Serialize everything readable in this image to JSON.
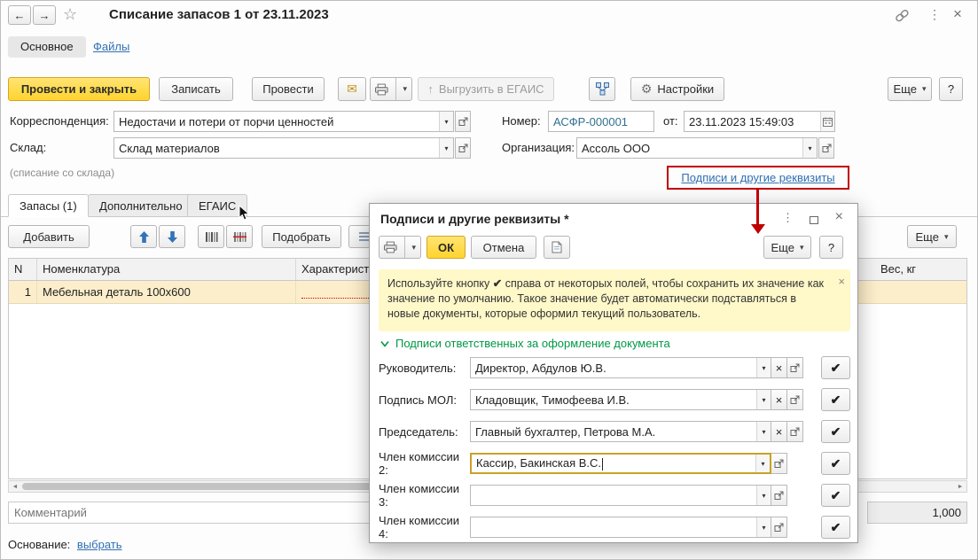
{
  "icons": {
    "back": "←",
    "forward": "→",
    "star": "☆",
    "kebab": "⋮",
    "close": "×",
    "dropdown": "▾",
    "help": "?",
    "envelope": "✉",
    "gear": "⚙",
    "up_arrow": "↑",
    "check": "✔",
    "clear": "×",
    "scroll_left": "◄",
    "scroll_right": "►"
  },
  "colors": {
    "accent_yellow": "#ffd42e",
    "link_blue": "#3070b3",
    "annotation_red": "#c00000",
    "section_green": "#009845",
    "selected_row": "#fceeca",
    "focus_border": "#c9a227",
    "info_bg": "#fff8c9"
  },
  "header": {
    "title": "Списание запасов 1 от 23.11.2023"
  },
  "nav_tabs": {
    "main": "Основное",
    "files": "Файлы"
  },
  "toolbar": {
    "post_and_close": "Провести и закрыть",
    "save": "Записать",
    "post": "Провести",
    "upload_egais": "Выгрузить в ЕГАИС",
    "settings": "Настройки",
    "more": "Еще",
    "help": "?"
  },
  "form": {
    "correspondence_label": "Корреспонденция:",
    "correspondence_value": "Недостачи и потери от порчи ценностей",
    "number_label": "Номер:",
    "number_value": "АСФР-000001",
    "date_label": "от:",
    "date_value": "23.11.2023 15:49:03",
    "warehouse_label": "Склад:",
    "warehouse_value": "Склад материалов",
    "warehouse_hint": "(списание со склада)",
    "org_label": "Организация:",
    "org_value": "Ассоль ООО",
    "signatures_link": "Подписи и другие реквизиты"
  },
  "items_tabs": {
    "stock": "Запасы (1)",
    "additional": "Дополнительно",
    "egais": "ЕГАИС"
  },
  "items_toolbar": {
    "add": "Добавить",
    "pick": "Подобрать",
    "more": "Еще"
  },
  "table": {
    "headers": [
      "N",
      "Номенклатура",
      "Характеристика",
      "Вес, кг"
    ],
    "rows": [
      {
        "n": "1",
        "nomenclature": "Мебельная деталь 100х600"
      }
    ],
    "weight_total": "1,000"
  },
  "footer": {
    "comment_placeholder": "Комментарий",
    "basis_label": "Основание:",
    "basis_link": "выбрать"
  },
  "dialog": {
    "title": "Подписи и другие реквизиты *",
    "ok": "ОК",
    "cancel": "Отмена",
    "more": "Еще",
    "help": "?",
    "info_prefix": "Используйте кнопку",
    "info_suffix": "справа от некоторых полей, чтобы сохранить их значение как значение по умолчанию. Такое значение будет автоматически подставляться в новые документы, которые оформил текущий пользователь.",
    "section_title": "Подписи ответственных за оформление документа",
    "fields": [
      {
        "label": "Руководитель:",
        "value": "Директор, Абдулов Ю.В."
      },
      {
        "label": "Подпись МОЛ:",
        "value": "Кладовщик, Тимофеева И.В."
      },
      {
        "label": "Председатель:",
        "value": "Главный бухгалтер, Петрова М.А."
      },
      {
        "label": "Член комиссии 2:",
        "value": "Кассир, Бакинская В.С."
      },
      {
        "label": "Член комиссии 3:",
        "value": ""
      },
      {
        "label": "Член комиссии 4:",
        "value": ""
      }
    ]
  }
}
